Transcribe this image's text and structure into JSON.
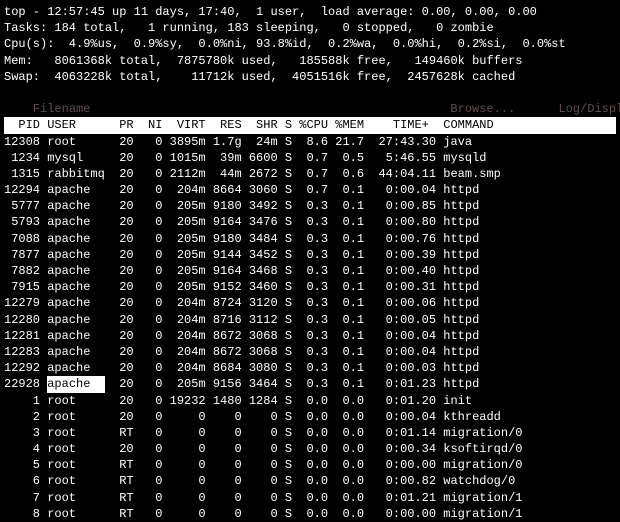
{
  "header": {
    "line1": "top - 12:57:45 up 11 days, 17:40,  1 user,  load average: 0.00, 0.00, 0.00",
    "line2": "Tasks: 184 total,   1 running, 183 sleeping,   0 stopped,   0 zombie",
    "line3": "Cpu(s):  4.9%us,  0.9%sy,  0.0%ni, 93.8%id,  0.2%wa,  0.0%hi,  0.2%si,  0.0%st",
    "line4": "Mem:   8061368k total,  7875780k used,   185588k free,   149460k buffers",
    "line5": "Swap:  4063228k total,    11712k used,  4051516k free,  2457628k cached",
    "ghost_left": "  Filename",
    "ghost_browse": "Browse...",
    "ghost_log": "Log/Display"
  },
  "columns": "  PID USER      PR  NI  VIRT  RES  SHR S %CPU %MEM    TIME+  COMMAND           ",
  "rows": [
    {
      "pid": "12308",
      "user": "root    ",
      "pr": "20",
      "ni": "  0",
      "virt": "3895m",
      "res": "1.7g",
      "shr": " 24m",
      "s": "S",
      "cpu": " 8.6",
      "mem": "21.7",
      "time": " 27:43.30",
      "cmd": "java"
    },
    {
      "pid": " 1234",
      "user": "mysql   ",
      "pr": "20",
      "ni": "  0",
      "virt": "1015m",
      "res": " 39m",
      "shr": "6600",
      "s": "S",
      "cpu": " 0.7",
      "mem": " 0.5",
      "time": "  5:46.55",
      "cmd": "mysqld"
    },
    {
      "pid": " 1315",
      "user": "rabbitmq",
      "pr": "20",
      "ni": "  0",
      "virt": "2112m",
      "res": " 44m",
      "shr": "2672",
      "s": "S",
      "cpu": " 0.7",
      "mem": " 0.6",
      "time": " 44:04.11",
      "cmd": "beam.smp"
    },
    {
      "pid": "12294",
      "user": "apache  ",
      "pr": "20",
      "ni": "  0",
      "virt": " 204m",
      "res": "8664",
      "shr": "3060",
      "s": "S",
      "cpu": " 0.7",
      "mem": " 0.1",
      "time": "  0:00.04",
      "cmd": "httpd"
    },
    {
      "pid": " 5777",
      "user": "apache  ",
      "pr": "20",
      "ni": "  0",
      "virt": " 205m",
      "res": "9180",
      "shr": "3492",
      "s": "S",
      "cpu": " 0.3",
      "mem": " 0.1",
      "time": "  0:00.85",
      "cmd": "httpd"
    },
    {
      "pid": " 5793",
      "user": "apache  ",
      "pr": "20",
      "ni": "  0",
      "virt": " 205m",
      "res": "9164",
      "shr": "3476",
      "s": "S",
      "cpu": " 0.3",
      "mem": " 0.1",
      "time": "  0:00.80",
      "cmd": "httpd"
    },
    {
      "pid": " 7088",
      "user": "apache  ",
      "pr": "20",
      "ni": "  0",
      "virt": " 205m",
      "res": "9180",
      "shr": "3484",
      "s": "S",
      "cpu": " 0.3",
      "mem": " 0.1",
      "time": "  0:00.76",
      "cmd": "httpd"
    },
    {
      "pid": " 7877",
      "user": "apache  ",
      "pr": "20",
      "ni": "  0",
      "virt": " 205m",
      "res": "9144",
      "shr": "3452",
      "s": "S",
      "cpu": " 0.3",
      "mem": " 0.1",
      "time": "  0:00.39",
      "cmd": "httpd"
    },
    {
      "pid": " 7882",
      "user": "apache  ",
      "pr": "20",
      "ni": "  0",
      "virt": " 205m",
      "res": "9164",
      "shr": "3468",
      "s": "S",
      "cpu": " 0.3",
      "mem": " 0.1",
      "time": "  0:00.40",
      "cmd": "httpd"
    },
    {
      "pid": " 7915",
      "user": "apache  ",
      "pr": "20",
      "ni": "  0",
      "virt": " 205m",
      "res": "9152",
      "shr": "3460",
      "s": "S",
      "cpu": " 0.3",
      "mem": " 0.1",
      "time": "  0:00.31",
      "cmd": "httpd"
    },
    {
      "pid": "12279",
      "user": "apache  ",
      "pr": "20",
      "ni": "  0",
      "virt": " 204m",
      "res": "8724",
      "shr": "3120",
      "s": "S",
      "cpu": " 0.3",
      "mem": " 0.1",
      "time": "  0:00.06",
      "cmd": "httpd"
    },
    {
      "pid": "12280",
      "user": "apache  ",
      "pr": "20",
      "ni": "  0",
      "virt": " 204m",
      "res": "8716",
      "shr": "3112",
      "s": "S",
      "cpu": " 0.3",
      "mem": " 0.1",
      "time": "  0:00.05",
      "cmd": "httpd"
    },
    {
      "pid": "12281",
      "user": "apache  ",
      "pr": "20",
      "ni": "  0",
      "virt": " 204m",
      "res": "8672",
      "shr": "3068",
      "s": "S",
      "cpu": " 0.3",
      "mem": " 0.1",
      "time": "  0:00.04",
      "cmd": "httpd"
    },
    {
      "pid": "12283",
      "user": "apache  ",
      "pr": "20",
      "ni": "  0",
      "virt": " 204m",
      "res": "8672",
      "shr": "3068",
      "s": "S",
      "cpu": " 0.3",
      "mem": " 0.1",
      "time": "  0:00.04",
      "cmd": "httpd"
    },
    {
      "pid": "12292",
      "user": "apache  ",
      "pr": "20",
      "ni": "  0",
      "virt": " 204m",
      "res": "8684",
      "shr": "3080",
      "s": "S",
      "cpu": " 0.3",
      "mem": " 0.1",
      "time": "  0:00.03",
      "cmd": "httpd"
    },
    {
      "pid": "22928",
      "user": "apache  ",
      "pr": "20",
      "ni": "  0",
      "virt": " 205m",
      "res": "9156",
      "shr": "3464",
      "s": "S",
      "cpu": " 0.3",
      "mem": " 0.1",
      "time": "  0:01.23",
      "cmd": "httpd",
      "hl": true
    },
    {
      "pid": "    1",
      "user": "root    ",
      "pr": "20",
      "ni": "  0",
      "virt": "19232",
      "res": "1480",
      "shr": "1284",
      "s": "S",
      "cpu": " 0.0",
      "mem": " 0.0",
      "time": "  0:01.20",
      "cmd": "init"
    },
    {
      "pid": "    2",
      "user": "root    ",
      "pr": "20",
      "ni": "  0",
      "virt": "    0",
      "res": "   0",
      "shr": "   0",
      "s": "S",
      "cpu": " 0.0",
      "mem": " 0.0",
      "time": "  0:00.04",
      "cmd": "kthreadd"
    },
    {
      "pid": "    3",
      "user": "root    ",
      "pr": "RT",
      "ni": "  0",
      "virt": "    0",
      "res": "   0",
      "shr": "   0",
      "s": "S",
      "cpu": " 0.0",
      "mem": " 0.0",
      "time": "  0:01.14",
      "cmd": "migration/0"
    },
    {
      "pid": "    4",
      "user": "root    ",
      "pr": "20",
      "ni": "  0",
      "virt": "    0",
      "res": "   0",
      "shr": "   0",
      "s": "S",
      "cpu": " 0.0",
      "mem": " 0.0",
      "time": "  0:00.34",
      "cmd": "ksoftirqd/0"
    },
    {
      "pid": "    5",
      "user": "root    ",
      "pr": "RT",
      "ni": "  0",
      "virt": "    0",
      "res": "   0",
      "shr": "   0",
      "s": "S",
      "cpu": " 0.0",
      "mem": " 0.0",
      "time": "  0:00.00",
      "cmd": "migration/0"
    },
    {
      "pid": "    6",
      "user": "root    ",
      "pr": "RT",
      "ni": "  0",
      "virt": "    0",
      "res": "   0",
      "shr": "   0",
      "s": "S",
      "cpu": " 0.0",
      "mem": " 0.0",
      "time": "  0:00.82",
      "cmd": "watchdog/0"
    },
    {
      "pid": "    7",
      "user": "root    ",
      "pr": "RT",
      "ni": "  0",
      "virt": "    0",
      "res": "   0",
      "shr": "   0",
      "s": "S",
      "cpu": " 0.0",
      "mem": " 0.0",
      "time": "  0:01.21",
      "cmd": "migration/1"
    },
    {
      "pid": "    8",
      "user": "root    ",
      "pr": "RT",
      "ni": "  0",
      "virt": "    0",
      "res": "   0",
      "shr": "   0",
      "s": "S",
      "cpu": " 0.0",
      "mem": " 0.0",
      "time": "  0:00.00",
      "cmd": "migration/1"
    }
  ]
}
